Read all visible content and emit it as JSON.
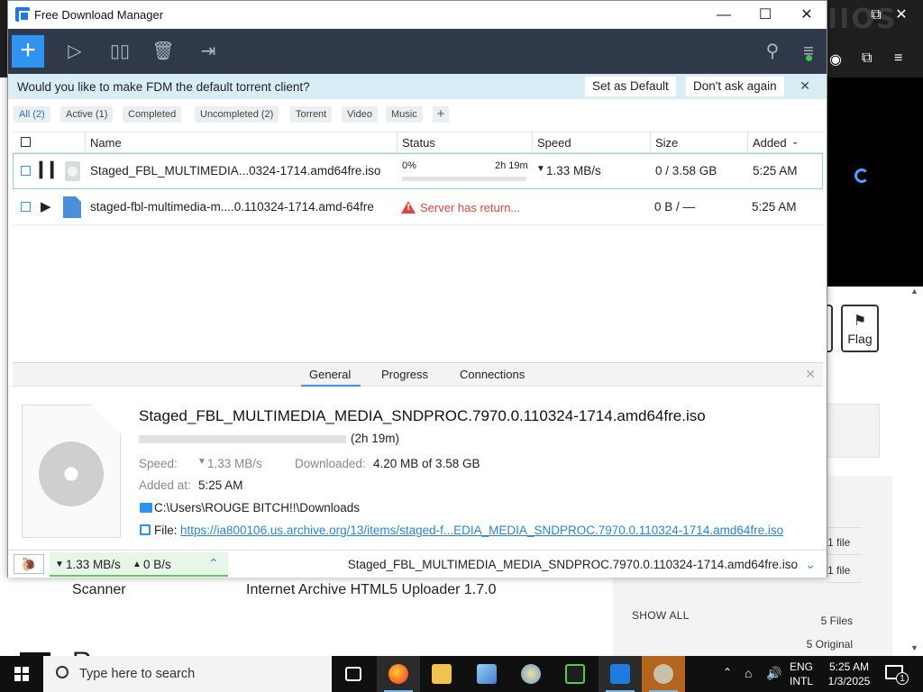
{
  "browser": {
    "flag_label": "Flag",
    "scanner": "Scanner",
    "uploader": "Internet Archive HTML5 Uploader 1.7.0",
    "show_all": "SHOW ALL",
    "files_count": "5 Files",
    "original_count": "5 Original",
    "side_rows": [
      "1 file",
      "1 file"
    ],
    "big_text": "R"
  },
  "fdm": {
    "window_title": "Free Download Manager",
    "banner": {
      "message": "Would you like to make FDM the default torrent client?",
      "set_default": "Set as Default",
      "dont_ask": "Don't ask again"
    },
    "filters": [
      "All (2)",
      "Active (1)",
      "Completed",
      "Uncompleted (2)",
      "Torrent",
      "Video",
      "Music"
    ],
    "columns": {
      "name": "Name",
      "status": "Status",
      "speed": "Speed",
      "size": "Size",
      "added": "Added"
    },
    "downloads": [
      {
        "name": "Staged_FBL_MULTIMEDIA...0324-1714.amd64fre.iso",
        "status_percent": "0%",
        "status_remaining": "2h 19m",
        "progress": 0.0,
        "speed": "1.33 MB/s",
        "size": "0 / 3.58 GB",
        "added": "5:25 AM"
      },
      {
        "name": "staged-fbl-multimedia-m....0.110324-1714.amd-64fre",
        "status_error": "Server has return...",
        "speed": "",
        "size": "0 B / —",
        "added": "5:25 AM"
      }
    ],
    "details": {
      "tabs": [
        "General",
        "Progress",
        "Connections"
      ],
      "file_name": "Staged_FBL_MULTIMEDIA_MEDIA_SNDPROC.7970.0.110324-1714.amd64fre.iso",
      "remaining": "(2h 19m)",
      "progress": 0.0,
      "speed_label": "Speed:",
      "speed_value": "1.33 MB/s",
      "downloaded_label": "Downloaded:",
      "downloaded_value": "4.20 MB of 3.58 GB",
      "added_label": "Added at:",
      "added_value": "5:25 AM",
      "path": "C:\\Users\\ROUGE BITCH!!\\Downloads",
      "file_label": "File:",
      "file_url": "https://ia800106.us.archive.org/13/items/staged-f...EDIA_MEDIA_SNDPROC.7970.0.110324-1714.amd64fre.iso"
    },
    "statusbar": {
      "down_speed": "1.33 MB/s",
      "up_speed": "0 B/s",
      "current_file": "Staged_FBL_MULTIMEDIA_MEDIA_SNDPROC.7970.0.110324-1714.amd64fre.iso"
    }
  },
  "taskbar": {
    "search_placeholder": "Type here to search",
    "lang_top": "ENG",
    "lang_bottom": "INTL",
    "time": "5:25 AM",
    "date": "1/3/2025",
    "notification_count": "1"
  },
  "colors": {
    "accent": "#2f93f0",
    "toolbar": "#30394a",
    "banner": "#d9edf7",
    "error": "#e04444",
    "speed_box": "#e7f6e7"
  }
}
